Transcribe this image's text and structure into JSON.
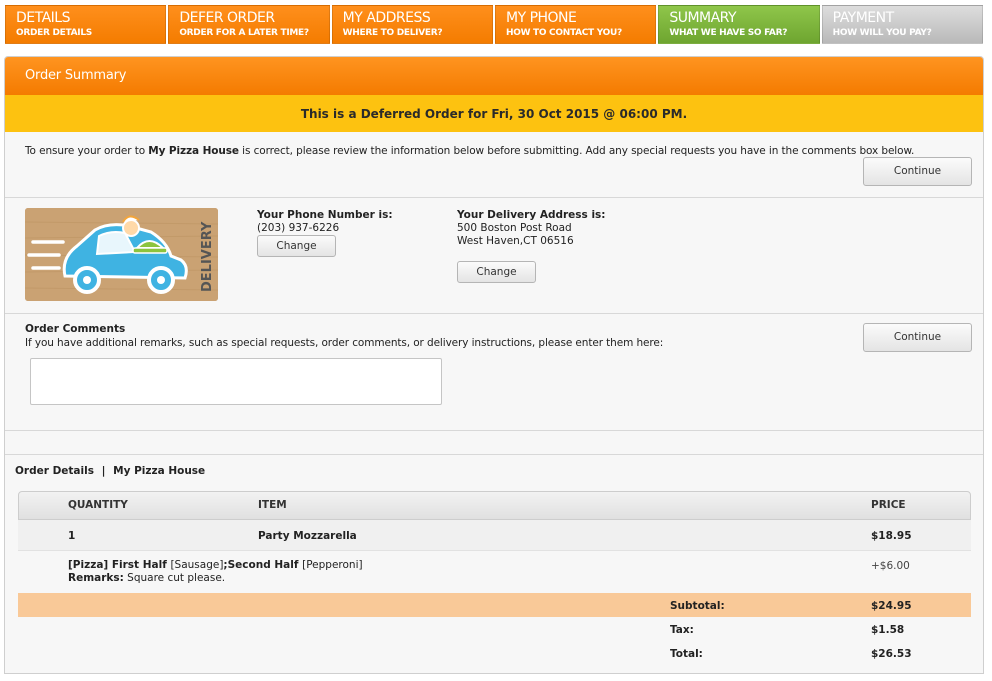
{
  "steps": [
    {
      "title": "Details",
      "sub": "Order Details"
    },
    {
      "title": "Defer Order",
      "sub": "Order for a later time?"
    },
    {
      "title": "My Address",
      "sub": "Where to deliver?"
    },
    {
      "title": "My Phone",
      "sub": "How to contact you?"
    },
    {
      "title": "Summary",
      "sub": "What we have so far?"
    },
    {
      "title": "Payment",
      "sub": "How will you pay?"
    }
  ],
  "panel": {
    "title": "Order Summary",
    "banner": "This is a Deferred Order for Fri, 30 Oct 2015 @ 06:00 PM.",
    "intro_before": "To ensure your order to ",
    "intro_store": "My Pizza House",
    "intro_after": " is correct, please review the information below before submitting. Add any special requests you have in the comments box below.",
    "continue_label": "Continue"
  },
  "delivery_image": {
    "text": "DELIVERY"
  },
  "phone": {
    "label": "Your Phone Number is:",
    "value": "(203) 937-6226",
    "change_label": "Change"
  },
  "address": {
    "label": "Your Delivery Address is:",
    "line1": "500 Boston Post Road",
    "line2": "West Haven,CT 06516",
    "change_label": "Change"
  },
  "comments": {
    "title": "Order Comments",
    "help": "If you have additional remarks, such as special requests, order comments, or delivery instructions, please enter them here:",
    "value": "",
    "continue_label": "Continue"
  },
  "order_details": {
    "label": "Order Details",
    "separator": "|",
    "store": "My Pizza House",
    "columns": {
      "quantity": "QUANTITY",
      "item": "ITEM",
      "price": "PRICE"
    },
    "items": [
      {
        "quantity": "1",
        "name": "Party Mozzarella",
        "price": "$18.95",
        "mod_prefix": "[Pizza] First Half ",
        "mod_first": "[Sausage]",
        "mod_mid": ";Second Half ",
        "mod_second": "[Pepperoni]",
        "mod_price": "+$6.00",
        "remarks_label": "Remarks:",
        "remarks": " Square cut please."
      }
    ],
    "subtotal_label": "Subtotal:",
    "subtotal": "$24.95",
    "tax_label": "Tax:",
    "tax": "$1.58",
    "total_label": "Total:",
    "total": "$26.53"
  }
}
